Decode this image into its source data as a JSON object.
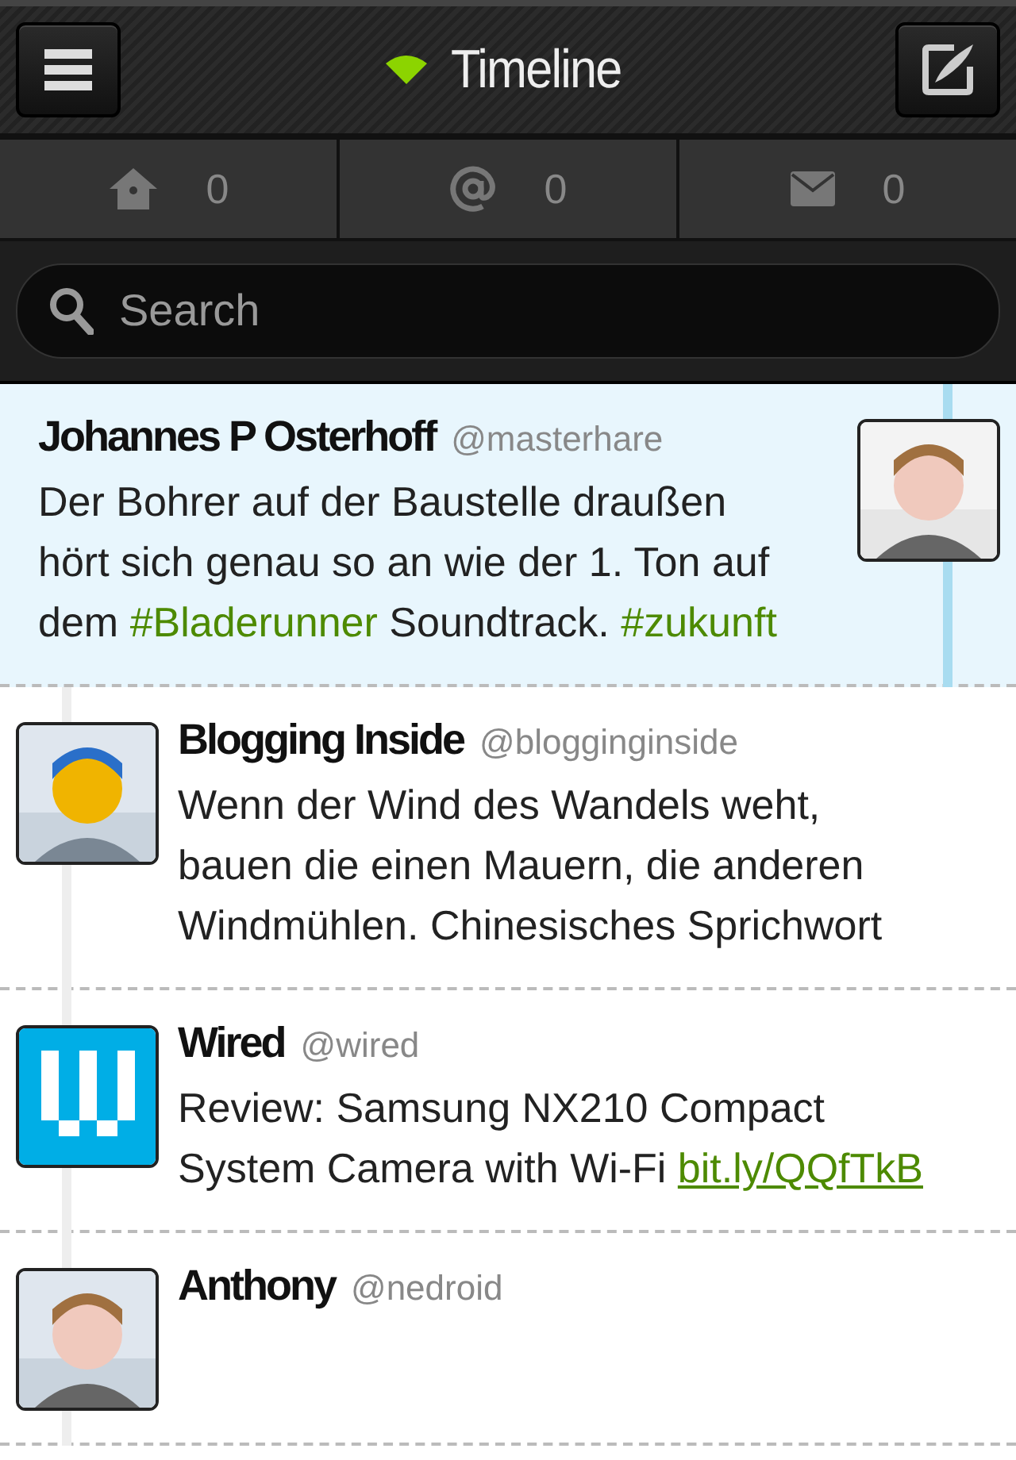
{
  "header": {
    "title": "Timeline",
    "connected": true
  },
  "tabs": [
    {
      "count": "0",
      "selected": false
    },
    {
      "count": "0",
      "selected": false
    },
    {
      "count": "0",
      "selected": false
    }
  ],
  "search": {
    "placeholder": "Search"
  },
  "tweets": [
    {
      "name": "Johannes P Osterhoff",
      "handle": "@masterhare",
      "selected": true,
      "avatar": {
        "kind": "picture"
      },
      "segments": [
        {
          "kind": "plain",
          "text": "Der Bohrer auf der Baustelle draußen hört sich genau so an wie der 1. Ton auf dem "
        },
        {
          "kind": "hashtag",
          "text": "#Bladerunner"
        },
        {
          "kind": "plain",
          "text": " Soundtrack. "
        },
        {
          "kind": "hashtag",
          "text": "#zukunft"
        }
      ]
    },
    {
      "name": "Blogging Inside",
      "handle": "@blogginginside",
      "selected": false,
      "avatar": {
        "kind": "picture"
      },
      "segments": [
        {
          "kind": "plain",
          "text": "Wenn der Wind des Wandels weht, bauen die einen Mauern, die anderen Windmühlen. Chinesisches Sprichwort"
        }
      ]
    },
    {
      "name": "Wired",
      "handle": "@wired",
      "selected": false,
      "avatar": {
        "kind": "logo"
      },
      "segments": [
        {
          "kind": "plain",
          "text": "Review: Samsung NX210 Compact System Camera with Wi-Fi "
        },
        {
          "kind": "link",
          "text": "bit.ly/QQfTkB"
        }
      ]
    },
    {
      "name": "Anthony",
      "handle": "@nedroid",
      "selected": false,
      "avatar": {
        "kind": "picture"
      }
    }
  ]
}
